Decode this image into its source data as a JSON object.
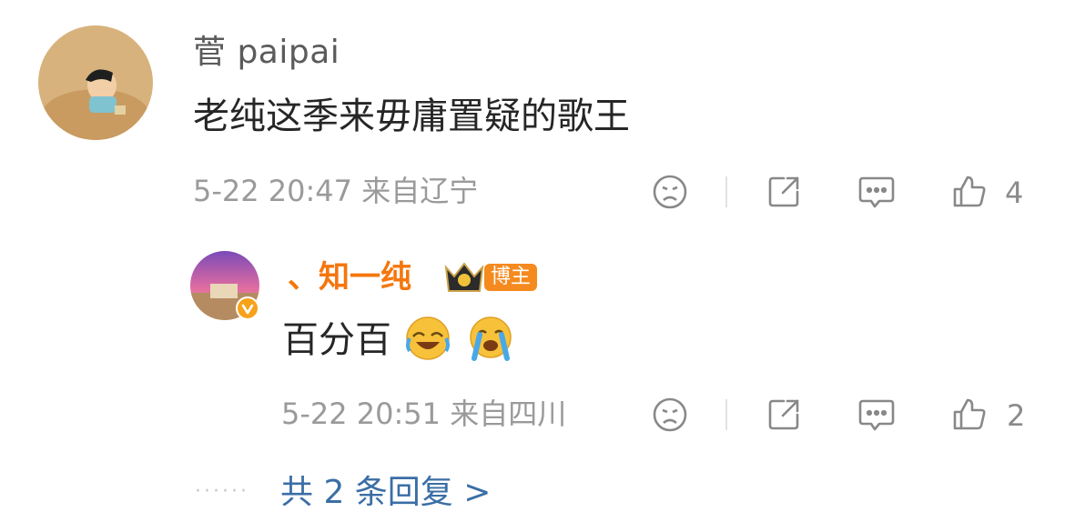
{
  "comment": {
    "username": "菅 paipai",
    "text": "老纯这季来毋庸置疑的歌王",
    "meta": "5-22 20:47 来自辽宁",
    "likes": "4"
  },
  "reply": {
    "username": "、知一纯",
    "badge": "博主",
    "text": "百分百",
    "emoji": [
      "laugh-cry-emoji",
      "crying-emoji"
    ],
    "meta": "5-22 20:51 来自四川",
    "likes": "2"
  },
  "more_replies": {
    "dots": "······",
    "label": "共 2 条回复 >"
  },
  "icons": [
    "dislike-icon",
    "share-icon",
    "comment-icon",
    "like-icon",
    "verified-icon",
    "crown-icon"
  ],
  "colors": {
    "link": "#3a6ea5",
    "host": "#f58a1f",
    "name_orange": "#f5760c"
  }
}
